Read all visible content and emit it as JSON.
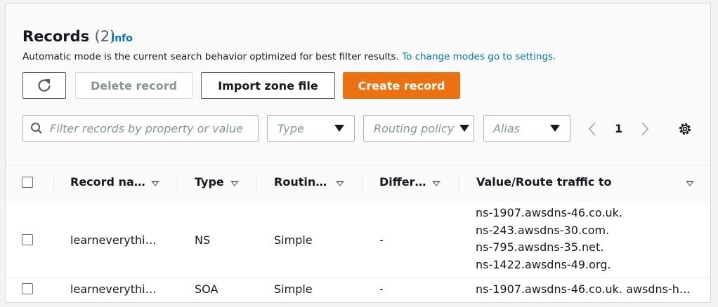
{
  "header": {
    "title": "Records",
    "count": "(2)",
    "info_link": "Info",
    "description": "Automatic mode is the current search behavior optimized for best filter results.",
    "settings_link": "To change modes go to settings."
  },
  "toolbar": {
    "delete_label": "Delete record",
    "import_label": "Import zone file",
    "create_label": "Create record"
  },
  "filters": {
    "search_placeholder": "Filter records by property or value",
    "type_label": "Type",
    "routing_label": "Routing policy",
    "alias_label": "Alias"
  },
  "pagination": {
    "current_page": "1"
  },
  "table": {
    "columns": [
      "Record na…",
      "Type",
      "Routin…",
      "Differ…",
      "Value/Route traffic to"
    ],
    "rows": [
      {
        "name": "learneverythi…",
        "type": "NS",
        "routing": "Simple",
        "differentiator": "-",
        "values": [
          "ns-1907.awsdns-46.co.uk.",
          "ns-243.awsdns-30.com.",
          "ns-795.awsdns-35.net.",
          "ns-1422.awsdns-49.org."
        ]
      },
      {
        "name": "learneverythi…",
        "type": "SOA",
        "routing": "Simple",
        "differentiator": "-",
        "values": [
          "ns-1907.awsdns-46.co.uk. awsdns-h…"
        ]
      }
    ]
  },
  "colors": {
    "primary": "#ec7211",
    "link": "#0073bb"
  },
  "icons": [
    "refresh-icon",
    "search-icon",
    "chevron-left-icon",
    "chevron-right-icon",
    "gear-icon",
    "caret-down-icon",
    "sort-icon"
  ]
}
